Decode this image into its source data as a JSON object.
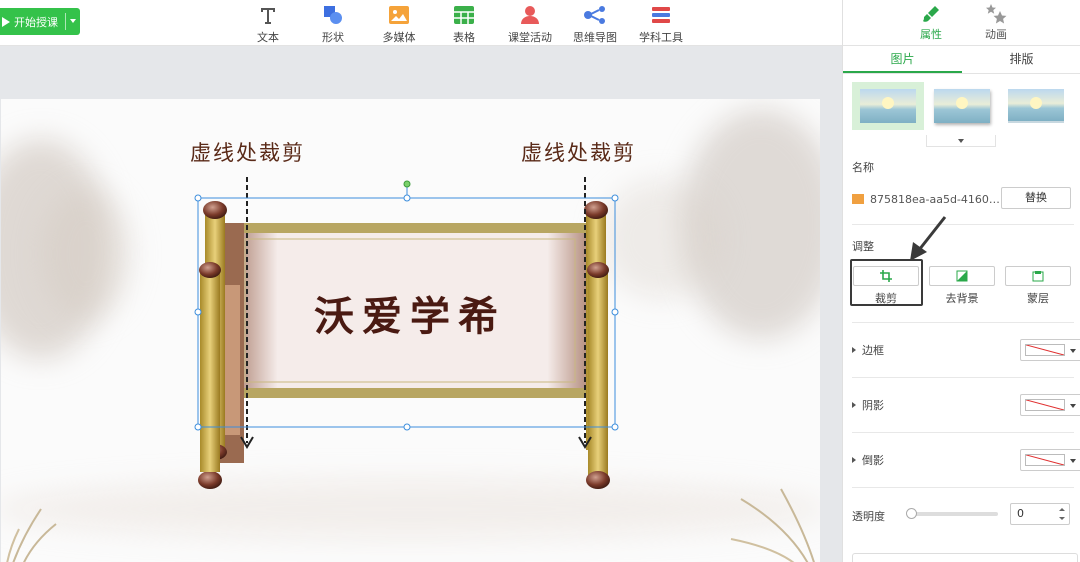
{
  "toolbar": {
    "start_button": "开始授课",
    "tools": [
      {
        "label": "文本",
        "icon": "text-icon"
      },
      {
        "label": "形状",
        "icon": "shape-icon"
      },
      {
        "label": "多媒体",
        "icon": "media-icon"
      },
      {
        "label": "表格",
        "icon": "table-icon"
      },
      {
        "label": "课堂活动",
        "icon": "classroom-activity-icon"
      },
      {
        "label": "思维导图",
        "icon": "mindmap-icon"
      },
      {
        "label": "学科工具",
        "icon": "subject-tools-icon"
      }
    ]
  },
  "slide": {
    "cut_label_left": "虚线处裁剪",
    "cut_label_right": "虚线处裁剪",
    "scroll_title": "沃爱学希"
  },
  "panel": {
    "tabs": [
      {
        "label": "属性",
        "icon": "brush-icon",
        "active": true
      },
      {
        "label": "动画",
        "icon": "stars-icon",
        "active": false
      }
    ],
    "subtabs": [
      {
        "label": "图片",
        "active": true
      },
      {
        "label": "排版",
        "active": false
      }
    ],
    "name_label": "名称",
    "file_name": "875818ea-aa5d-4160-8...",
    "replace_button": "替换",
    "adjust_label": "调整",
    "adjust_buttons": [
      {
        "label": "裁剪",
        "icon": "crop-icon"
      },
      {
        "label": "去背景",
        "icon": "remove-bg-icon"
      },
      {
        "label": "蒙层",
        "icon": "mask-icon"
      }
    ],
    "props": [
      {
        "label": "边框"
      },
      {
        "label": "阴影"
      },
      {
        "label": "倒影"
      }
    ],
    "opacity_label": "透明度",
    "opacity_value": "0"
  },
  "colors": {
    "accent": "#2aa84a",
    "start_button": "#34c24a",
    "selection": "#3c8ddc",
    "scroll_text": "#4a1a12"
  }
}
